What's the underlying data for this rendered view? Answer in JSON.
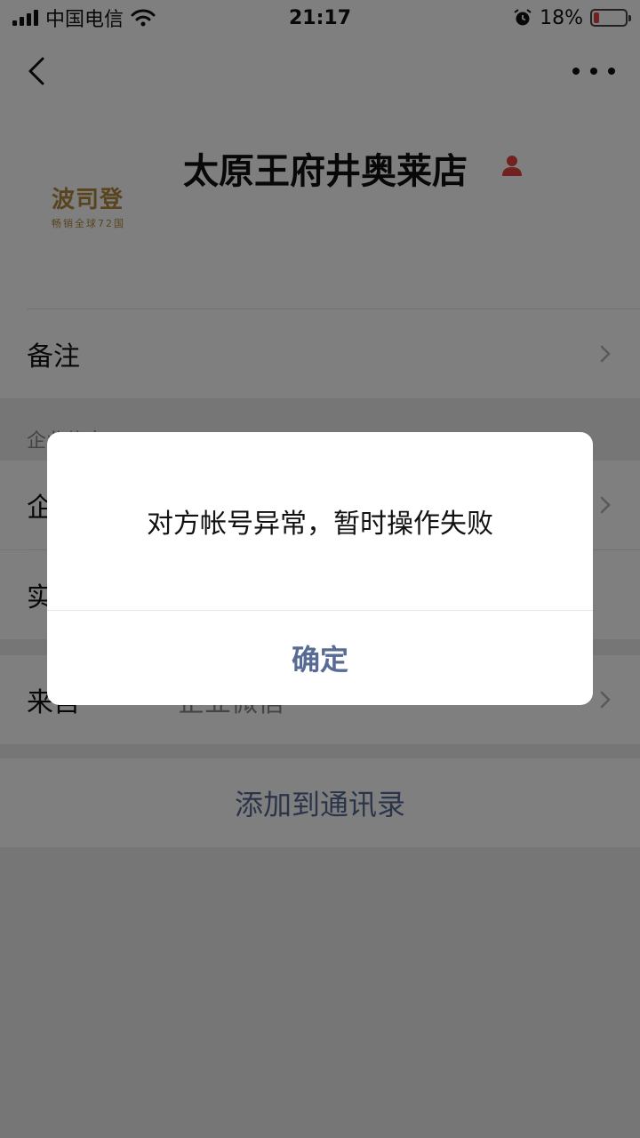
{
  "status_bar": {
    "carrier": "中国电信",
    "time": "21:17",
    "battery_percent": "18%",
    "battery_level": 0.18,
    "icons": [
      "signal-icon",
      "wifi-icon",
      "alarm-icon",
      "battery-icon"
    ]
  },
  "nav": {
    "back_icon": "chevron-left-icon",
    "more_icon": "more-dots-icon"
  },
  "profile": {
    "name": "太原王府井奥莱店",
    "logo_main": "波司登",
    "logo_sub": "畅销全球72国",
    "person_icon": "person-icon",
    "person_icon_color": "#e64340"
  },
  "rows": {
    "remark_label": "备注",
    "section_title": "企业信息",
    "company_label": "企",
    "real_name_label": "实",
    "source_label": "来自",
    "source_value": "企业微信"
  },
  "add_contact_label": "添加到通讯录",
  "dialog": {
    "message": "对方帐号异常，暂时操作失败",
    "confirm_label": "确定"
  },
  "colors": {
    "link": "#576b95",
    "overlay": "rgba(0,0,0,0.5)"
  }
}
